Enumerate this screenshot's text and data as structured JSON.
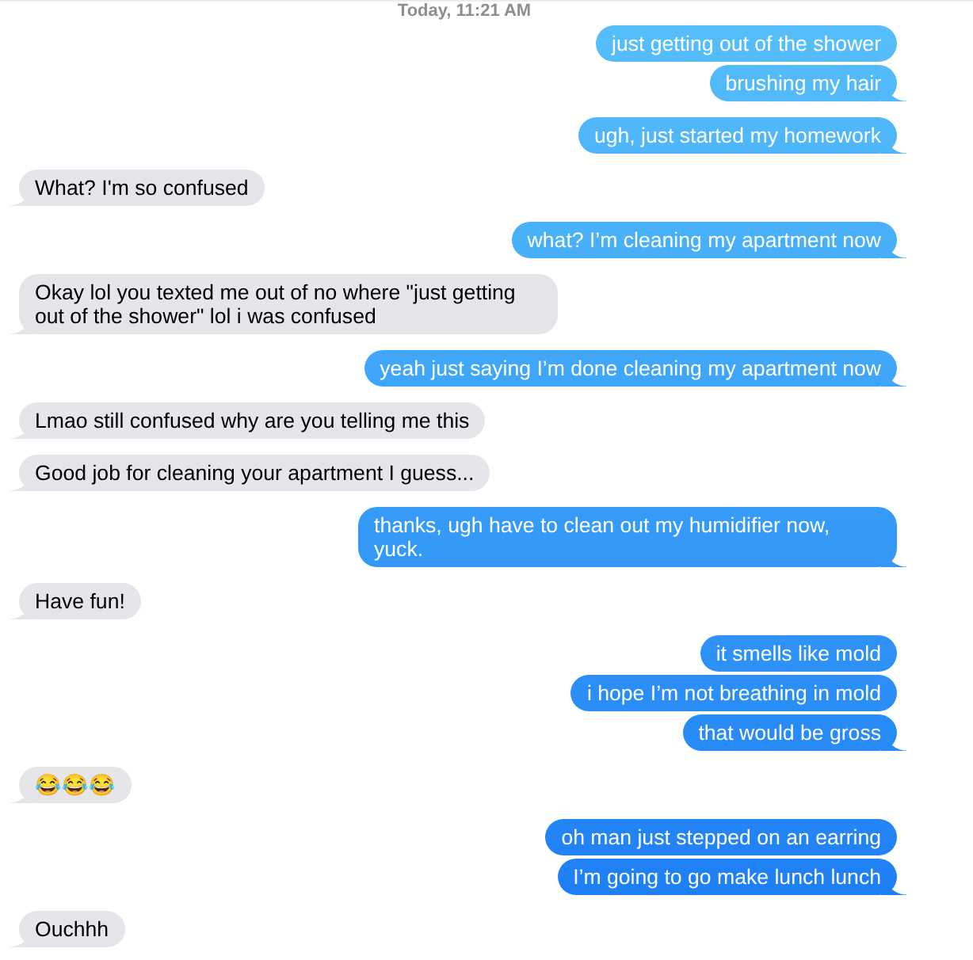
{
  "timestamp": "Today, 11:21 AM",
  "groups": [
    {
      "from_me": true,
      "messages": [
        "just getting out of the shower",
        "brushing my hair"
      ]
    },
    {
      "from_me": true,
      "messages": [
        "ugh, just started my homework"
      ]
    },
    {
      "from_me": false,
      "messages": [
        "What? I'm so confused"
      ]
    },
    {
      "from_me": true,
      "messages": [
        "what? I’m cleaning my apartment now"
      ]
    },
    {
      "from_me": false,
      "messages": [
        "Okay lol you texted me out of no where \"just getting out of the shower\" lol i was confused"
      ]
    },
    {
      "from_me": true,
      "messages": [
        "yeah just saying I’m done cleaning my apartment now"
      ]
    },
    {
      "from_me": false,
      "messages": [
        "Lmao still confused why are you telling me this"
      ]
    },
    {
      "from_me": false,
      "messages": [
        "Good job for cleaning your apartment I guess..."
      ]
    },
    {
      "from_me": true,
      "messages": [
        "thanks, ugh have to clean out my humidifier now, yuck."
      ]
    },
    {
      "from_me": false,
      "messages": [
        "Have fun!"
      ]
    },
    {
      "from_me": true,
      "messages": [
        "it smells like mold",
        "i hope I’m not breathing in mold",
        "that would be gross"
      ]
    },
    {
      "from_me": false,
      "messages": [
        "😂😂😂"
      ]
    },
    {
      "from_me": true,
      "messages": [
        "oh man just stepped on an earring",
        "I’m going to go make lunch lunch"
      ]
    },
    {
      "from_me": false,
      "messages": [
        "Ouchhh"
      ]
    }
  ]
}
